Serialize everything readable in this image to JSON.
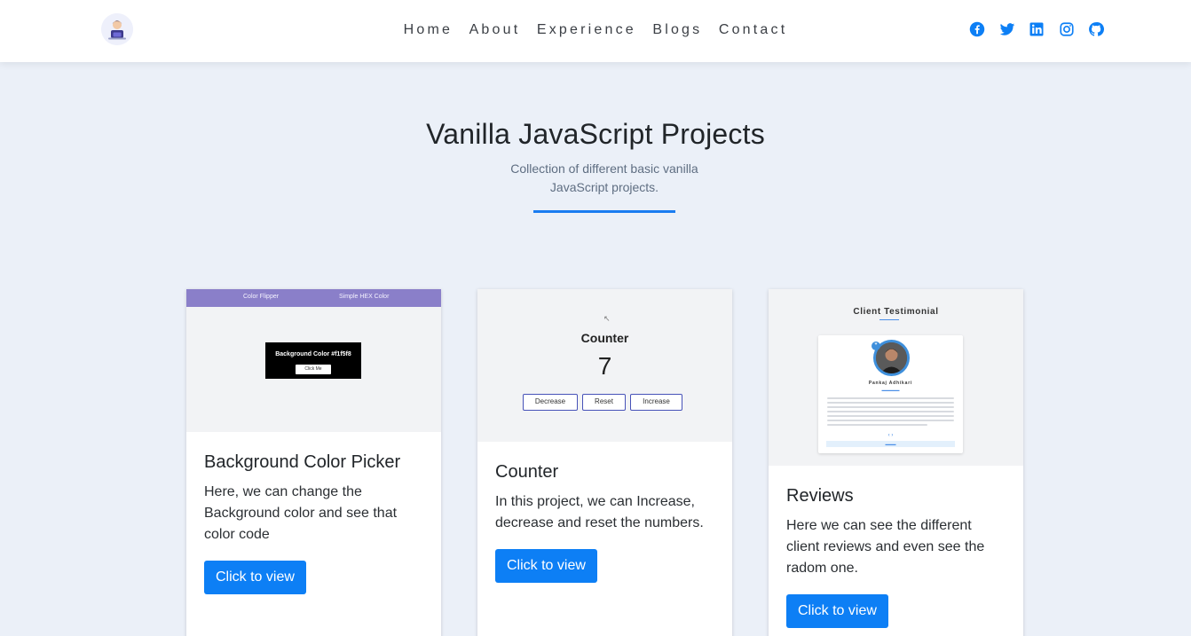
{
  "navbar": {
    "links": [
      {
        "label": "Home"
      },
      {
        "label": "About"
      },
      {
        "label": "Experience"
      },
      {
        "label": "Blogs"
      },
      {
        "label": "Contact"
      }
    ],
    "socials": [
      {
        "icon": "facebook-icon",
        "color": "#0d7ff5"
      },
      {
        "icon": "twitter-icon",
        "color": "#0d7ff5"
      },
      {
        "icon": "linkedin-icon",
        "color": "#0d7ff5"
      },
      {
        "icon": "instagram-icon",
        "color": "#0d7ff5"
      },
      {
        "icon": "github-icon",
        "color": "#0d7ff5"
      }
    ]
  },
  "hero": {
    "title": "Vanilla JavaScript Projects",
    "subtitle": "Collection of different basic vanilla JavaScript projects."
  },
  "colors": {
    "accent": "#0d7ff5",
    "background": "#ebf0f8"
  },
  "projects": [
    {
      "title": "Background Color Picker",
      "description": "Here, we can change the Background color and see that color code",
      "button": "Click to view",
      "preview": {
        "nav_left": "Color Flipper",
        "nav_right": "Simple HEX Color",
        "label": "Background Color #f1f5f8",
        "button": "Click Me"
      }
    },
    {
      "title": "Counter",
      "description": "In this project, we can Increase, decrease and reset the numbers.",
      "button": "Click to view",
      "preview": {
        "title": "Counter",
        "value": "7",
        "decrease": "Decrease",
        "reset": "Reset",
        "increase": "Increase"
      }
    },
    {
      "title": "Reviews",
      "description": "Here we can see the different client reviews and even see the radom one.",
      "button": "Click to view",
      "preview": {
        "title": "Client Testimonial",
        "name": "Pankaj Adhikari",
        "arrows": "‹  ›"
      }
    }
  ]
}
